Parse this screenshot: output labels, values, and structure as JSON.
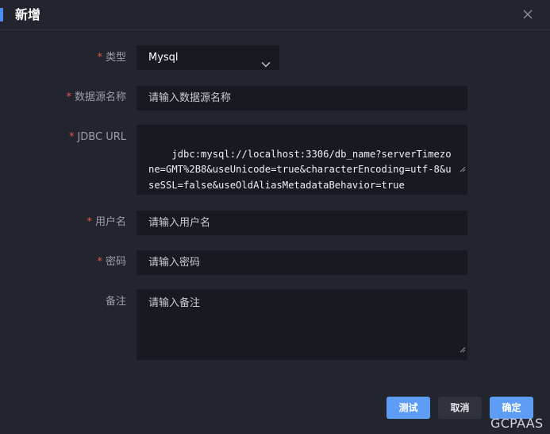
{
  "dialog": {
    "title": "新增"
  },
  "form": {
    "type": {
      "required_mark": "*",
      "label": "类型",
      "value": "Mysql"
    },
    "name": {
      "required_mark": "*",
      "label": "数据源名称",
      "placeholder": "请输入数据源名称"
    },
    "jdbc": {
      "required_mark": "*",
      "label": "JDBC URL",
      "value": "jdbc:mysql://localhost:3306/db_name?serverTimezone=GMT%2B8&useUnicode=true&characterEncoding=utf-8&useSSL=false&useOldAliasMetadataBehavior=true"
    },
    "username": {
      "required_mark": "*",
      "label": "用户名",
      "placeholder": "请输入用户名"
    },
    "password": {
      "required_mark": "*",
      "label": "密码",
      "placeholder": "请输入密码"
    },
    "remark": {
      "label": "备注",
      "placeholder": "请输入备注"
    }
  },
  "footer": {
    "test_label": "测试",
    "cancel_label": "取消",
    "confirm_label": "确定"
  },
  "watermark": "GCPAAS",
  "colors": {
    "background": "#23252e",
    "field_background": "#181a21",
    "primary": "#5e9df5",
    "required": "#e2574c",
    "title_accent": "#4d8bf5"
  }
}
